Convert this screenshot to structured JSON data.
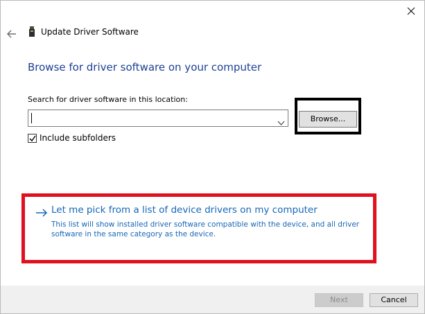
{
  "window": {
    "title": "Update Driver Software",
    "heading": "Browse for driver software on your computer"
  },
  "search": {
    "label": "Search for driver software in this location:",
    "value": "",
    "browse_label": "Browse..."
  },
  "options": {
    "include_subfolders_label": "Include subfolders",
    "include_subfolders_checked": true
  },
  "pick_option": {
    "title": "Let me pick from a list of device drivers on my computer",
    "description": "This list will show installed driver software compatible with the device, and all driver software in the same category as the device."
  },
  "footer": {
    "next_label": "Next",
    "next_enabled": false,
    "cancel_label": "Cancel"
  },
  "icons": {
    "close": "close-icon",
    "back": "back-arrow-icon",
    "app": "usb-device-icon",
    "dropdown": "chevron-down-icon",
    "check": "checkmark-icon",
    "link_arrow": "right-arrow-icon"
  },
  "colors": {
    "heading": "#1c3f95",
    "link": "#1466b8",
    "highlight_red": "#e0101e",
    "highlight_black": "#000000"
  }
}
